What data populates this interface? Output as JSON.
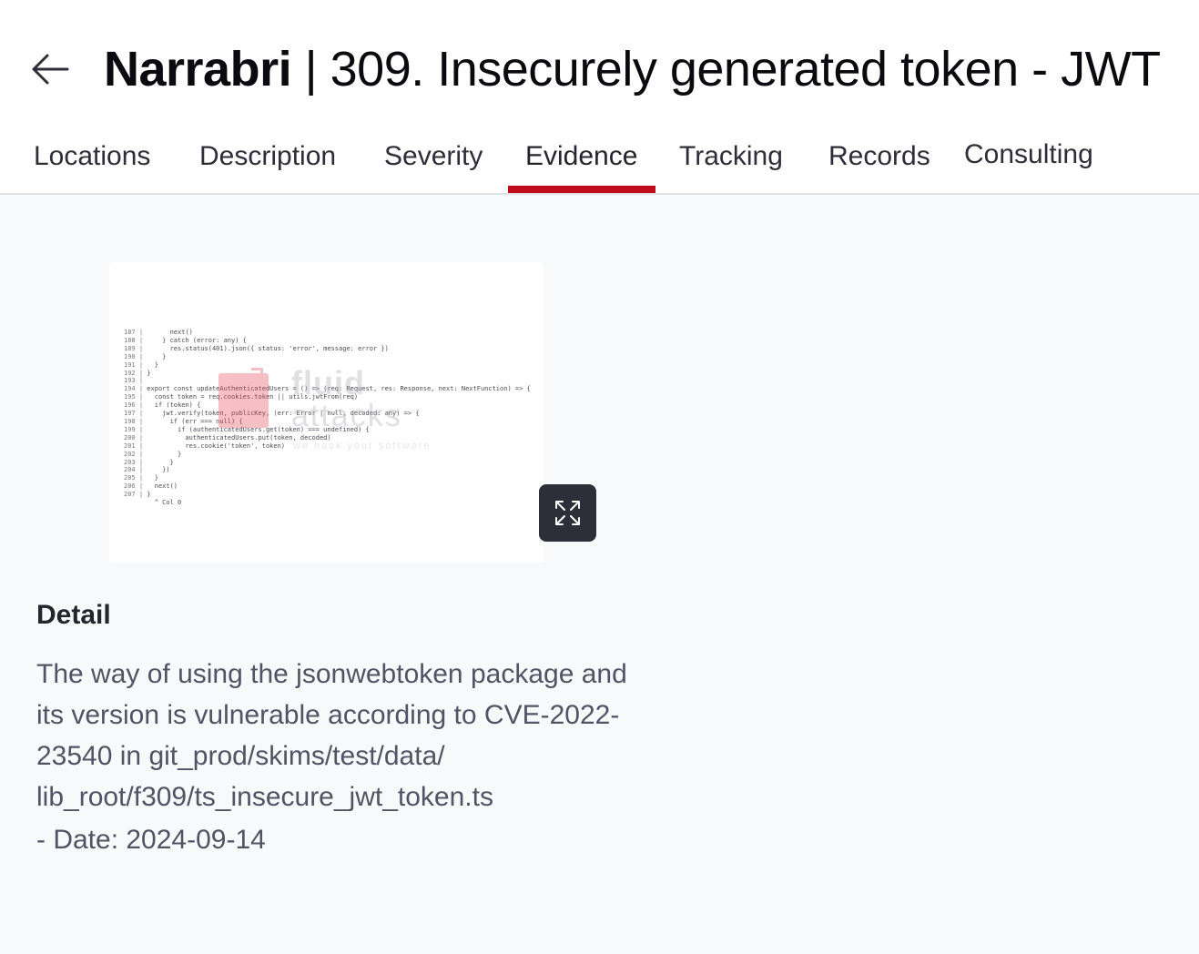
{
  "header": {
    "back_icon": "arrow-left-icon",
    "title_org": "Narrabri",
    "title_rest": " | 309. Insecurely generated token - JWT"
  },
  "tabs": [
    {
      "label": "Locations"
    },
    {
      "label": "Description"
    },
    {
      "label": "Severity"
    },
    {
      "label": "Evidence",
      "active": true
    },
    {
      "label": "Tracking"
    },
    {
      "label": "Records"
    },
    {
      "label": "Consulting"
    }
  ],
  "evidence": {
    "expand_icon": "expand-arrows-icon",
    "watermark": {
      "word1": "fluid",
      "word2": "attacks",
      "tagline": "we hack your software"
    },
    "code_lines": [
      {
        "n": "187",
        "t": "      next()"
      },
      {
        "n": "188",
        "t": "    } catch (error: any) {"
      },
      {
        "n": "189",
        "t": "      res.status(401).json({ status: 'error', message: error })"
      },
      {
        "n": "190",
        "t": "    }"
      },
      {
        "n": "191",
        "t": "  }"
      },
      {
        "n": "192",
        "t": "}"
      },
      {
        "n": "193",
        "t": ""
      },
      {
        "n": "194",
        "t": "export const updateAuthenticatedUsers = () => (req: Request, res: Response, next: NextFunction) => {"
      },
      {
        "n": "195",
        "t": "  const token = req.cookies.token || utils.jwtFrom(req)"
      },
      {
        "n": "196",
        "t": "  if (token) {"
      },
      {
        "n": "197",
        "t": "    jwt.verify(token, publicKey, (err: Error | null, decoded: any) => {"
      },
      {
        "n": "198",
        "t": "      if (err === null) {"
      },
      {
        "n": "199",
        "t": "        if (authenticatedUsers.get(token) === undefined) {"
      },
      {
        "n": "200",
        "t": "          authenticatedUsers.put(token, decoded)"
      },
      {
        "n": "201",
        "t": "          res.cookie('token', token)"
      },
      {
        "n": "202",
        "t": "        }"
      },
      {
        "n": "203",
        "t": "      }"
      },
      {
        "n": "204",
        "t": "    })"
      },
      {
        "n": "205",
        "t": "  }"
      },
      {
        "n": "206",
        "t": "  next()"
      },
      {
        "n": "207",
        "t": "}"
      },
      {
        "n": "",
        "t": "  ^ Col 0"
      }
    ]
  },
  "detail": {
    "heading": "Detail",
    "text": "The way of using the jsonwebtoken package and its version is vulnerable according to CVE-2022-23540 in git_prod/skims/test/data/ lib_root/f309/ts_insecure_jwt_token.ts",
    "date": "- Date: 2024-09-14"
  },
  "colors": {
    "accent": "#bf0b1a",
    "button_dark": "#2e2e38",
    "background": "#f7f9fb"
  }
}
